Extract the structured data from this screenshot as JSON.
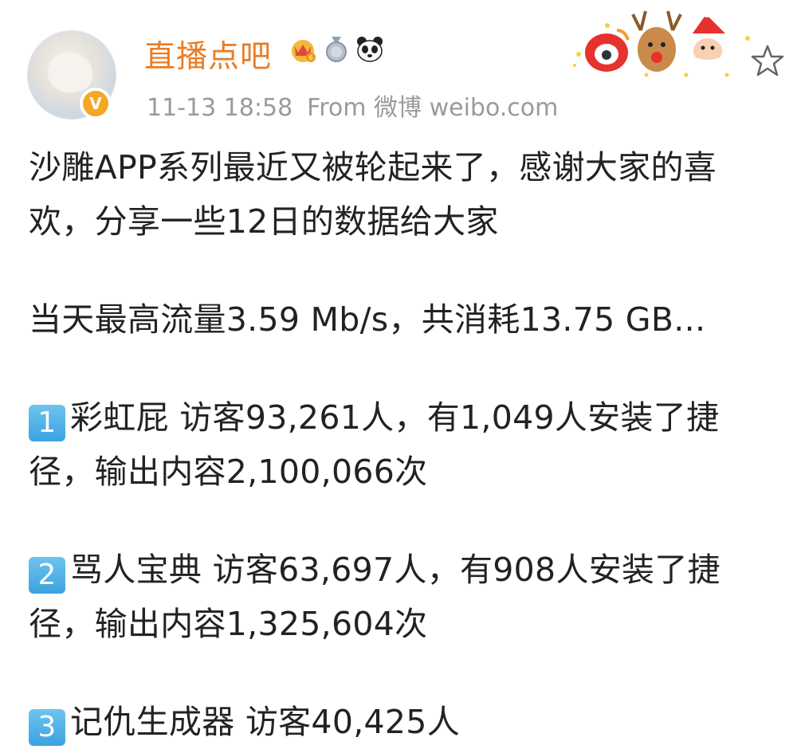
{
  "post": {
    "author": "直播点吧",
    "badges": [
      "crown-badge-icon",
      "medal-badge-icon",
      "panda-icon"
    ],
    "time": "11-13 18:58",
    "source": "From 微博 weibo.com",
    "verified_mark": "V",
    "paragraphs": [
      {
        "lines": [
          "沙雕APP系列最近又被轮起来了，感谢大家的喜",
          "欢，分享一些12日的数据给大家"
        ]
      },
      {
        "lines": [
          "当天最高流量3.59 Mb/s，共消耗13.75 GB..."
        ]
      },
      {
        "key": "1",
        "lines": [
          "彩虹屁 访客93,261人，有1,049人安装了捷",
          "径，输出内容2,100,066次"
        ]
      },
      {
        "key": "2",
        "lines": [
          "骂人宝典 访客63,697人，有908人安装了捷",
          "径，输出内容1,325,604次"
        ]
      },
      {
        "key": "3",
        "lines": [
          "记仇生成器 访客40,425人"
        ]
      }
    ]
  },
  "colors": {
    "author": "#ea7d24",
    "meta": "#9a9a9a",
    "verified": "#f5a623",
    "numkey": "#3aa3e0"
  }
}
